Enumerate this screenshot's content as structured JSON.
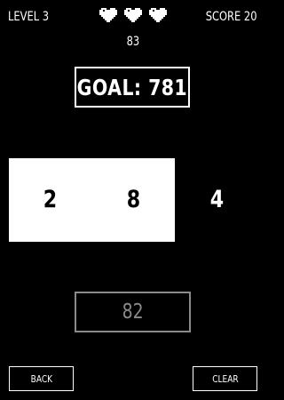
{
  "hud": {
    "level": "LEVEL 3",
    "score": "SCORE 20",
    "lives_count": 3,
    "heart_icon": "heart-icon",
    "timer": "83"
  },
  "goal": {
    "label": "GOAL: 781"
  },
  "tiles": [
    {
      "value": "2",
      "selected": true
    },
    {
      "value": "8",
      "selected": true
    },
    {
      "value": "4",
      "selected": false
    }
  ],
  "current_total": "82",
  "buttons": {
    "back": "BACK",
    "clear": "CLEAR"
  },
  "colors": {
    "background": "#000000",
    "foreground": "#ffffff",
    "dimmed": "#8a8a8a"
  }
}
